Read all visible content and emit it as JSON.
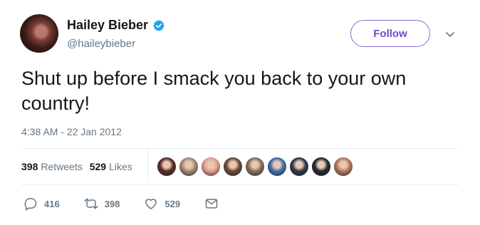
{
  "author": {
    "name": "Hailey Bieber",
    "handle": "@haileybieber",
    "verified": true
  },
  "follow_label": "Follow",
  "tweet": {
    "text": "Shut up before I smack you back to your own country!",
    "timestamp": "4:38 AM - 22 Jan 2012"
  },
  "stats": {
    "retweets_count": "398",
    "retweets_label": "Retweets",
    "likes_count": "529",
    "likes_label": "Likes"
  },
  "likers": [
    {
      "color": "#5a2b2b"
    },
    {
      "color": "#a58b78"
    },
    {
      "color": "#e2a090"
    },
    {
      "color": "#6b4a3a"
    },
    {
      "color": "#8a6f5e"
    },
    {
      "color": "#3f6fb0"
    },
    {
      "color": "#2f3a4a"
    },
    {
      "color": "#1e2a33"
    },
    {
      "color": "#b47a62"
    }
  ],
  "actions": {
    "replies": "416",
    "retweets": "398",
    "likes": "529"
  },
  "colors": {
    "accent": "#6e48c7",
    "verified": "#1da1f2",
    "muted": "#657786",
    "text": "#14171a"
  }
}
